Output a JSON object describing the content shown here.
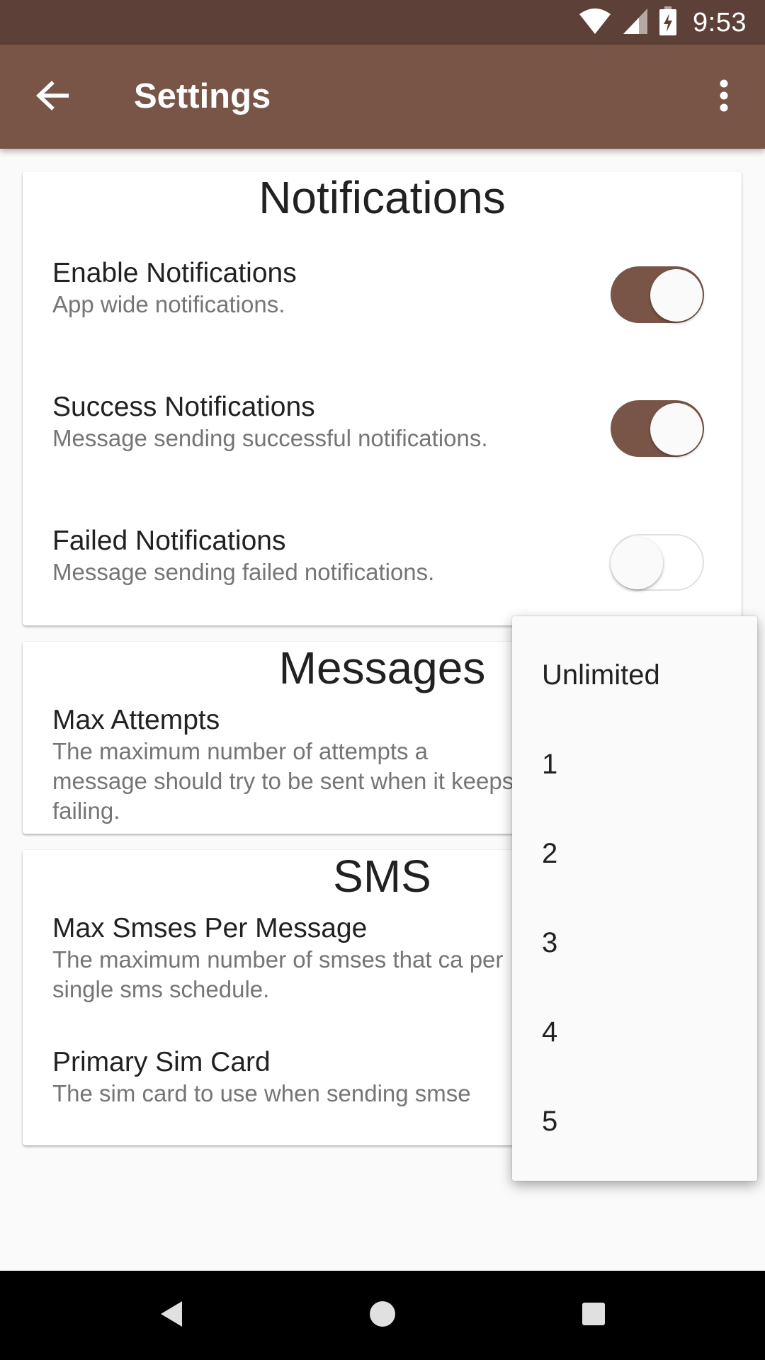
{
  "status_bar": {
    "time": "9:53",
    "icons": [
      "wifi-icon",
      "cell-signal-icon",
      "battery-charging-icon"
    ]
  },
  "app_bar": {
    "title": "Settings",
    "back_icon": "arrow-back-icon",
    "menu_icon": "more-vert-icon"
  },
  "colors": {
    "status_bar": "#5d4037",
    "app_bar": "#795548",
    "switch_on_track": "#795548",
    "background": "#fafafa"
  },
  "notifications": {
    "title": "Notifications",
    "items": [
      {
        "title": "Enable Notifications",
        "desc": "App wide notifications.",
        "enabled": true
      },
      {
        "title": "Success Notifications",
        "desc": "Message sending successful notifications.",
        "enabled": true
      },
      {
        "title": "Failed Notifications",
        "desc": "Message sending failed notifications.",
        "enabled": false
      }
    ]
  },
  "messages": {
    "title": "Messages",
    "items": [
      {
        "title": "Max Attempts",
        "desc": "The maximum number of attempts a message should try to be sent when it keeps failing."
      }
    ]
  },
  "sms": {
    "title": "SMS",
    "items": [
      {
        "title": "Max Smses Per Message",
        "desc": "The maximum number of smses that ca per single sms schedule."
      },
      {
        "title": "Primary Sim Card",
        "desc": "The sim card to use when sending smse"
      }
    ]
  },
  "dropdown": {
    "options": [
      "Unlimited",
      "1",
      "2",
      "3",
      "4",
      "5"
    ]
  },
  "nav_bar": {
    "icons": [
      "back-triangle-icon",
      "home-circle-icon",
      "recents-square-icon"
    ]
  }
}
